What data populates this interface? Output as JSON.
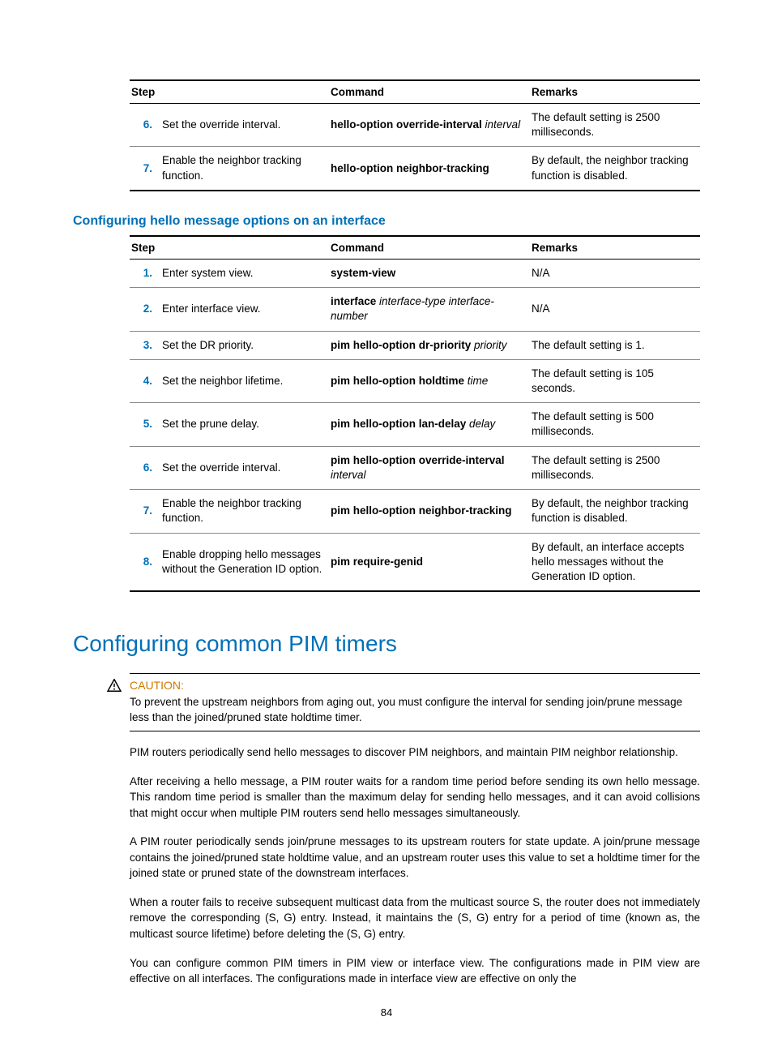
{
  "table1": {
    "headers": [
      "Step",
      "Command",
      "Remarks"
    ],
    "rows": [
      {
        "num": "6.",
        "step": "Set the override interval.",
        "cmd_bold": "hello-option override-interval",
        "cmd_italic": "interval",
        "remarks": "The default setting is 2500 milliseconds."
      },
      {
        "num": "7.",
        "step": "Enable the neighbor tracking function.",
        "cmd_bold": "hello-option neighbor-tracking",
        "cmd_italic": "",
        "remarks": "By default, the neighbor tracking function is disabled."
      }
    ]
  },
  "subheading": "Configuring hello message options on an interface",
  "table2": {
    "headers": [
      "Step",
      "Command",
      "Remarks"
    ],
    "rows": [
      {
        "num": "1.",
        "step": "Enter system view.",
        "cmd_bold": "system-view",
        "cmd_italic": "",
        "remarks": "N/A"
      },
      {
        "num": "2.",
        "step": "Enter interface view.",
        "cmd_bold": "interface",
        "cmd_italic": "interface-type interface-number",
        "remarks": "N/A"
      },
      {
        "num": "3.",
        "step": "Set the DR priority.",
        "cmd_bold": "pim hello-option dr-priority",
        "cmd_italic": "priority",
        "remarks": "The default setting is 1."
      },
      {
        "num": "4.",
        "step": "Set the neighbor lifetime.",
        "cmd_bold": "pim hello-option holdtime",
        "cmd_italic": "time",
        "remarks": "The default setting is 105 seconds."
      },
      {
        "num": "5.",
        "step": "Set the prune delay.",
        "cmd_bold": "pim hello-option lan-delay",
        "cmd_italic": "delay",
        "remarks": "The default setting is 500 milliseconds."
      },
      {
        "num": "6.",
        "step": "Set the override interval.",
        "cmd_bold": "pim hello-option override-interval",
        "cmd_italic": "interval",
        "remarks": "The default setting is 2500 milliseconds."
      },
      {
        "num": "7.",
        "step": "Enable the neighbor tracking function.",
        "cmd_bold": "pim hello-option neighbor-tracking",
        "cmd_italic": "",
        "remarks": "By default, the neighbor tracking function is disabled."
      },
      {
        "num": "8.",
        "step": "Enable dropping hello messages without the Generation ID option.",
        "cmd_bold": "pim require-genid",
        "cmd_italic": "",
        "remarks": "By default, an interface accepts hello messages without the Generation ID option."
      }
    ]
  },
  "main_heading": "Configuring common PIM timers",
  "caution_label": "CAUTION:",
  "caution_text": "To prevent the upstream neighbors from aging out, you must configure the interval for sending join/prune message less than the joined/pruned state holdtime timer.",
  "paragraphs": [
    "PIM routers periodically send hello messages to discover PIM neighbors, and maintain PIM neighbor relationship.",
    "After receiving a hello message, a PIM router waits for a random time period before sending its own hello message. This random time period is smaller than the maximum delay for sending hello messages, and it can avoid collisions that might occur when multiple PIM routers send hello messages simultaneously.",
    "A PIM router periodically sends join/prune messages to its upstream routers for state update. A join/prune message contains the joined/pruned state holdtime value, and an upstream router uses this value to set a holdtime timer for the joined state or pruned state of the downstream interfaces.",
    "When a router fails to receive subsequent multicast data from the multicast source S, the router does not immediately remove the corresponding (S, G) entry. Instead, it maintains the (S, G) entry for a period of time (known as, the multicast source lifetime) before deleting the (S, G) entry.",
    "You can configure common PIM timers in PIM view or interface view. The configurations made in PIM view are effective on all interfaces. The configurations made in interface view are effective on only the"
  ],
  "page_number": "84"
}
